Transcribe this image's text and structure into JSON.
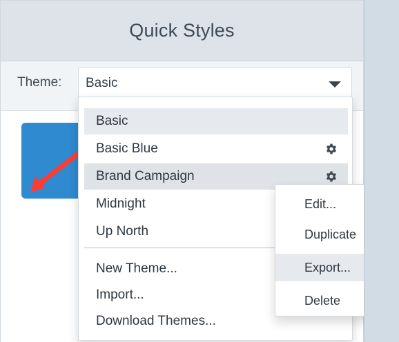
{
  "panel": {
    "title": "Quick Styles",
    "theme_label": "Theme:",
    "theme_value": "Basic",
    "caret_icon": "chevron-down-icon"
  },
  "theme_menu": {
    "items": [
      {
        "label": "Basic",
        "state": "active"
      },
      {
        "label": "Basic Blue",
        "icon": "gear-icon"
      },
      {
        "label": "Brand Campaign",
        "icon": "gear-icon",
        "state": "hover"
      },
      {
        "label": "Midnight"
      },
      {
        "label": "Up North"
      },
      {
        "label": "New Theme..."
      },
      {
        "label": "Import..."
      },
      {
        "label": "Download Themes..."
      }
    ]
  },
  "context_menu": {
    "items": [
      {
        "label": "Edit..."
      },
      {
        "label": "Duplicate"
      },
      {
        "label": "Export...",
        "state": "hover"
      },
      {
        "label": "Delete"
      }
    ]
  },
  "colors": {
    "preview_blue": "#2f8ad0",
    "arrow_red": "#ff3c32"
  }
}
